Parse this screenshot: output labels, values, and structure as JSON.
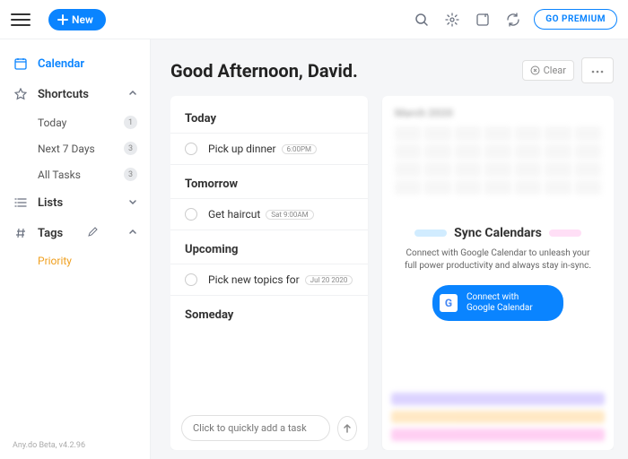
{
  "topbar": {
    "new_label": "New",
    "premium_label": "GO PREMIUM"
  },
  "sidebar": {
    "calendar": "Calendar",
    "shortcuts": "Shortcuts",
    "shortcut_items": [
      {
        "label": "Today",
        "count": "1"
      },
      {
        "label": "Next 7 Days",
        "count": "3"
      },
      {
        "label": "All Tasks",
        "count": "3"
      }
    ],
    "lists": "Lists",
    "tags": "Tags",
    "tag_items": [
      "Priority"
    ],
    "footer": "Any.do Beta, v4.2.96"
  },
  "main": {
    "greeting": "Good Afternoon, David.",
    "clear_label": "Clear",
    "sections": {
      "today": "Today",
      "tomorrow": "Tomorrow",
      "upcoming": "Upcoming",
      "someday": "Someday"
    },
    "tasks": {
      "today": {
        "text": "Pick up dinner",
        "badge": "6:00PM"
      },
      "tomorrow": {
        "text": "Get haircut",
        "badge": "Sat 9:00AM"
      },
      "upcoming": {
        "text": "Pick new topics for",
        "badge": "Jul 20 2020"
      }
    },
    "add_placeholder": "Click to quickly add a task"
  },
  "sync": {
    "title": "Sync Calendars",
    "desc": "Connect with Google Calendar to unleash your full power productivity and always stay in-sync.",
    "connect_label": "Connect with Google Calendar",
    "month": "March 2020"
  }
}
